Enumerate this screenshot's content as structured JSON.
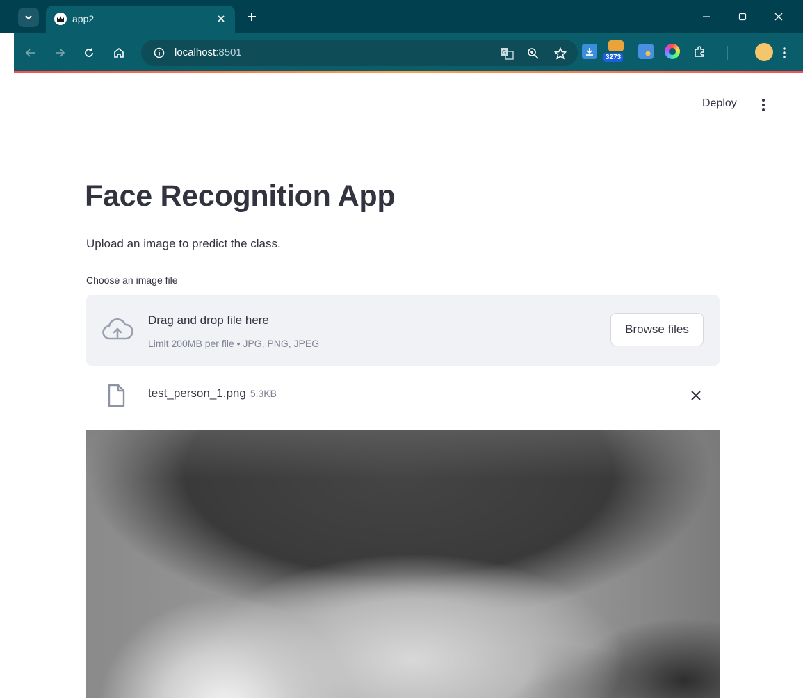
{
  "browser": {
    "tab_title": "app2",
    "url_host": "localhost",
    "url_port": ":8501",
    "extension_badge": "3273"
  },
  "header": {
    "deploy_label": "Deploy"
  },
  "main": {
    "title": "Face Recognition App",
    "subtitle": "Upload an image to predict the class.",
    "uploader": {
      "label": "Choose an image file",
      "drop_text": "Drag and drop file here",
      "limit_text": "Limit 200MB per file • JPG, PNG, JPEG",
      "browse_label": "Browse files"
    },
    "uploaded_file": {
      "name": "test_person_1.png",
      "size": "5.3KB"
    }
  },
  "colors": {
    "browser_frame": "#00404f",
    "browser_toolbar": "#0a5d6b",
    "text": "#31333f",
    "muted_text": "#808495",
    "dropzone_bg": "#f0f2f6",
    "accent": "#ff4b4b"
  },
  "icons": {
    "tab_menu": "chevron-down-icon",
    "favicon": "crown-icon",
    "close_tab": "close-icon",
    "new_tab": "plus-icon",
    "back": "arrow-left-icon",
    "forward": "arrow-right-icon",
    "reload": "reload-icon",
    "home": "home-icon",
    "site_info": "info-icon",
    "translate": "translate-icon",
    "zoom": "zoom-icon",
    "bookmark": "star-icon",
    "upload": "cloud-upload-icon",
    "file": "file-icon",
    "remove_file": "close-icon",
    "main_menu": "kebab-menu-icon"
  }
}
